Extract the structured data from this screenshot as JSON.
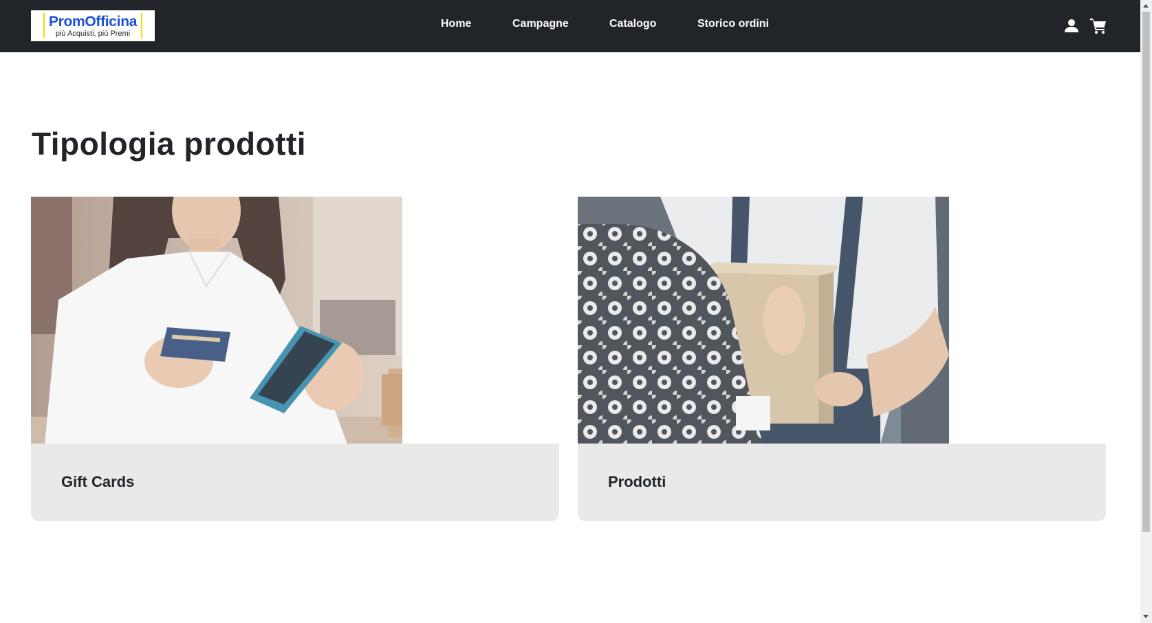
{
  "header": {
    "logo": {
      "name": "PromOfficina",
      "tagline": "più Acquisti, più Premi"
    },
    "nav": [
      {
        "label": "Home"
      },
      {
        "label": "Campagne"
      },
      {
        "label": "Catalogo"
      },
      {
        "label": "Storico ordini"
      }
    ],
    "icons": {
      "user": "user-icon",
      "cart": "cart-icon"
    }
  },
  "main": {
    "title": "Tipologia prodotti",
    "cards": [
      {
        "title": "Gift Cards",
        "image": "woman-with-credit-card-and-phone"
      },
      {
        "title": "Prodotti",
        "image": "courier-delivering-box"
      }
    ]
  },
  "colors": {
    "header_bg": "#212529",
    "card_footer_bg": "#e9e9e9",
    "text_dark": "#212529",
    "logo_blue": "#1a4fd8",
    "logo_yellow": "#f0e000"
  }
}
